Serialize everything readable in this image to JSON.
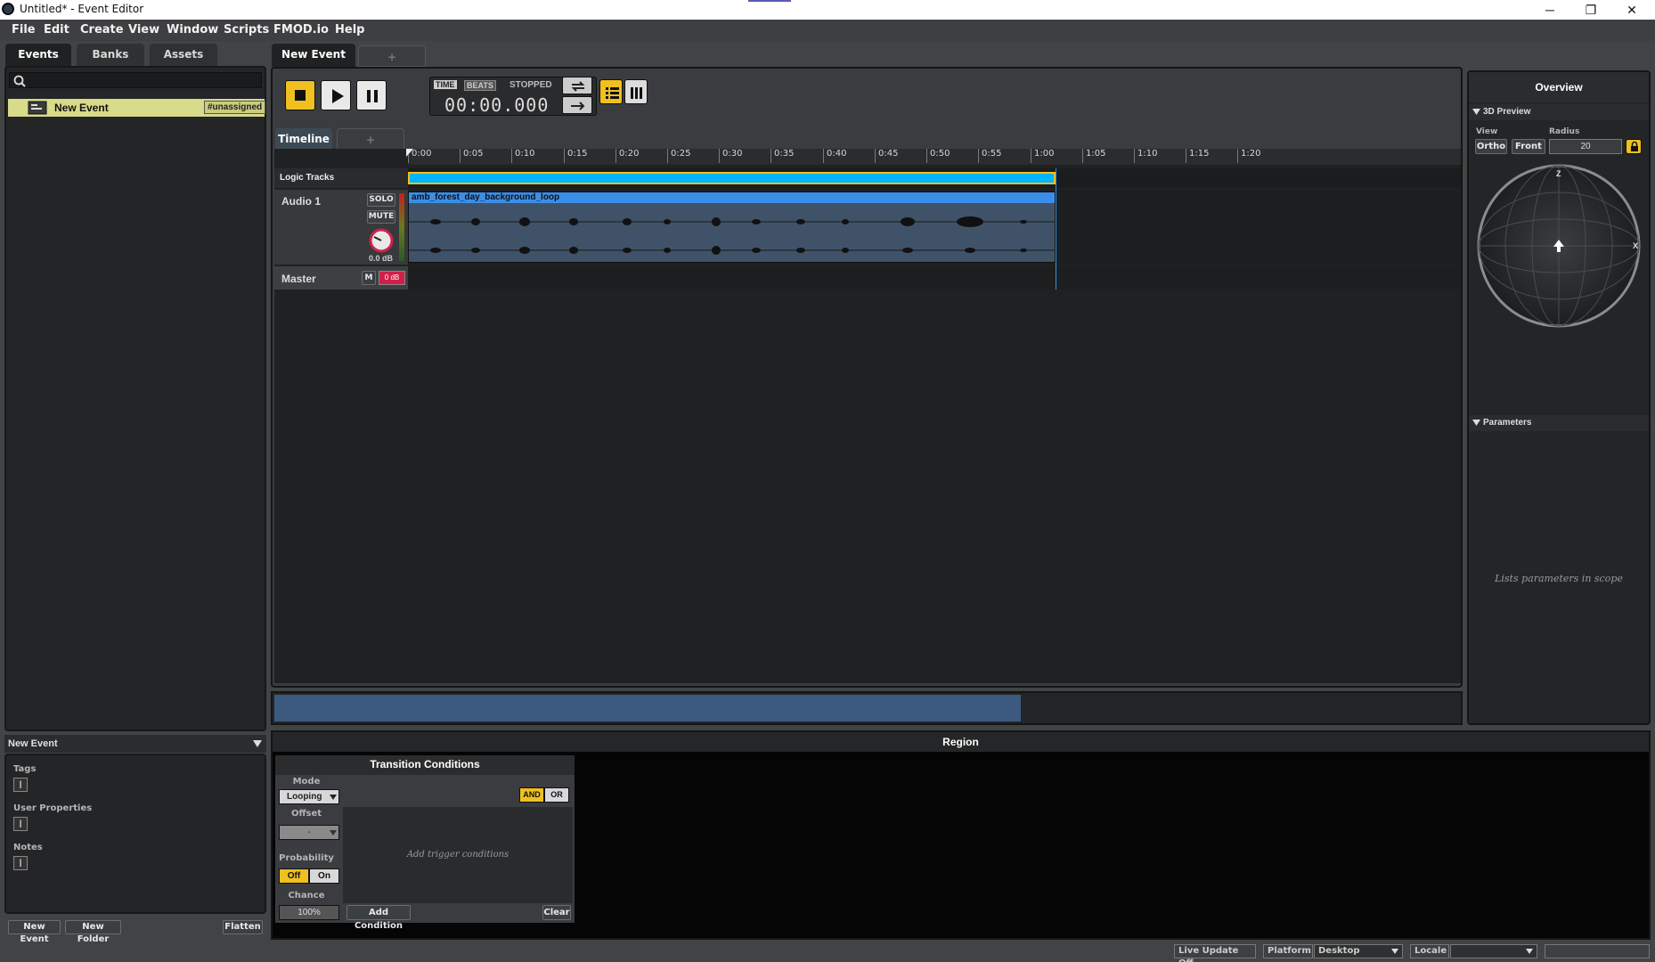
{
  "window": {
    "title": "Untitled* - Event Editor",
    "minimize": "─",
    "restore": "❐",
    "close": "✕"
  },
  "menu": [
    "File",
    "Edit",
    "Create",
    "View",
    "Window",
    "Scripts",
    "FMOD.io",
    "Help"
  ],
  "left_tabs": [
    "Events",
    "Banks",
    "Assets"
  ],
  "search": {
    "placeholder": ""
  },
  "event_item": {
    "name": "New Event",
    "tag": "#unassigned"
  },
  "inspector": {
    "title": "New Event",
    "tags_label": "Tags",
    "user_props_label": "User Properties",
    "notes_label": "Notes",
    "buttons": {
      "new_event": "New Event",
      "new_folder": "New Folder",
      "flatten": "Flatten"
    }
  },
  "editor_tabs": {
    "active": "New Event",
    "add": "+"
  },
  "transport": {
    "mode_time": "TIME",
    "mode_beats": "BEATS",
    "state": "STOPPED",
    "time": "00:00.000"
  },
  "view_tabs": {
    "active": "Timeline",
    "add": "+"
  },
  "ruler": [
    "0:00",
    "0:05",
    "0:10",
    "0:15",
    "0:20",
    "0:25",
    "0:30",
    "0:35",
    "0:40",
    "0:45",
    "0:50",
    "0:55",
    "1:00",
    "1:05",
    "1:10",
    "1:15",
    "1:20"
  ],
  "tracks": {
    "logic_label": "Logic Tracks",
    "audio": {
      "name": "Audio 1",
      "solo": "SOLO",
      "mute": "MUTE",
      "volume": "0.0 dB",
      "clip": "amb_forest_day_background_loop"
    },
    "master": {
      "name": "Master",
      "m": "M",
      "level": "0 dB"
    }
  },
  "overview": {
    "title": "Overview",
    "preview_title": "3D Preview",
    "view_label": "View",
    "radius_label": "Radius",
    "ortho": "Ortho",
    "front": "Front",
    "radius_value": "20",
    "axis_z": "Z",
    "axis_x": "X",
    "parameters_title": "Parameters",
    "parameters_empty": "Lists parameters in scope"
  },
  "region": {
    "title": "Region",
    "transition_title": "Transition Conditions",
    "mode_label": "Mode",
    "mode_value": "Looping",
    "offset_label": "Offset",
    "offset_value": "-",
    "probability_label": "Probability",
    "prob_off": "Off",
    "prob_on": "On",
    "chance_label": "Chance",
    "chance_value": "100%",
    "and": "AND",
    "or": "OR",
    "empty_hint": "Add trigger conditions",
    "add_condition": "Add Condition",
    "clear": "Clear"
  },
  "status": {
    "live_update": "Live Update Off",
    "platform_label": "Platform",
    "platform_value": "Desktop",
    "locale_label": "Locale",
    "locale_value": ""
  },
  "colors": {
    "accent": "#f0c020",
    "clip": "#3b8ee8",
    "logic_track": "#00b4ff",
    "selection": "#d7db8a"
  }
}
